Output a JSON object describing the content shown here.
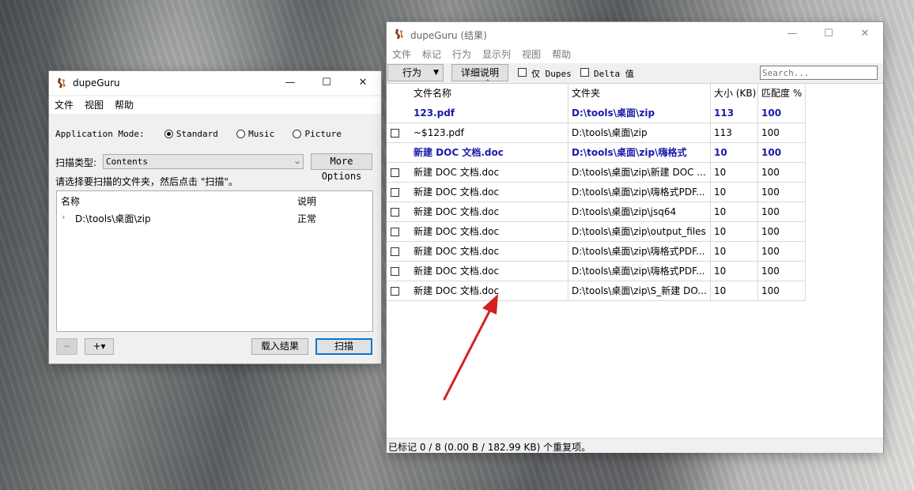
{
  "colors": {
    "ref_text": "#1a1aa8",
    "accent_border": "#0078d7",
    "arrow": "#d32020"
  },
  "main_window": {
    "title": "dupeGuru",
    "controls": {
      "minimize": "—",
      "maximize": "☐",
      "close": "✕"
    },
    "menu": [
      "文件",
      "视图",
      "帮助"
    ],
    "app_mode_label": "Application Mode:",
    "modes": [
      {
        "label": "Standard",
        "selected": true
      },
      {
        "label": "Music",
        "selected": false
      },
      {
        "label": "Picture",
        "selected": false
      }
    ],
    "scan_type_label": "扫描类型:",
    "scan_type_value": "Contents",
    "more_options": "More Options",
    "instruction": "请选择要扫描的文件夹，然后点击 \"扫描\"。",
    "folder_columns": [
      "名称",
      "说明"
    ],
    "folders": [
      {
        "name": "D:\\tools\\桌面\\zip",
        "state": "正常"
      }
    ],
    "remove_btn": "−",
    "add_btn": "+▾",
    "load_results": "载入结果",
    "scan": "扫描"
  },
  "results_window": {
    "title": "dupeGuru (结果)",
    "controls": {
      "minimize": "—",
      "maximize": "☐",
      "close": "✕"
    },
    "menu": [
      "文件",
      "标记",
      "行为",
      "显示列",
      "视图",
      "帮助"
    ],
    "action_btn": "行为",
    "details_btn": "详细说明",
    "dupes_only": "仅 Dupes",
    "delta": "Delta 值",
    "search_placeholder": "Search...",
    "columns": [
      "文件名称",
      "文件夹",
      "大小 (KB)",
      "匹配度 %"
    ],
    "rows": [
      {
        "ref": true,
        "name": "123.pdf",
        "folder": "D:\\tools\\桌面\\zip",
        "size": "113",
        "match": "100"
      },
      {
        "ref": false,
        "name": "~$123.pdf",
        "folder": "D:\\tools\\桌面\\zip",
        "size": "113",
        "match": "100"
      },
      {
        "ref": true,
        "name": "新建 DOC 文档.doc",
        "folder": "D:\\tools\\桌面\\zip\\嗨格式",
        "size": "10",
        "match": "100"
      },
      {
        "ref": false,
        "name": "新建 DOC 文档.doc",
        "folder": "D:\\tools\\桌面\\zip\\新建 DOC ...",
        "size": "10",
        "match": "100"
      },
      {
        "ref": false,
        "name": "新建 DOC 文档.doc",
        "folder": "D:\\tools\\桌面\\zip\\嗨格式PDF...",
        "size": "10",
        "match": "100"
      },
      {
        "ref": false,
        "name": "新建 DOC 文档.doc",
        "folder": "D:\\tools\\桌面\\zip\\jsq64",
        "size": "10",
        "match": "100"
      },
      {
        "ref": false,
        "name": "新建 DOC 文档.doc",
        "folder": "D:\\tools\\桌面\\zip\\output_files",
        "size": "10",
        "match": "100"
      },
      {
        "ref": false,
        "name": "新建 DOC 文档.doc",
        "folder": "D:\\tools\\桌面\\zip\\嗨格式PDF...",
        "size": "10",
        "match": "100"
      },
      {
        "ref": false,
        "name": "新建 DOC 文档.doc",
        "folder": "D:\\tools\\桌面\\zip\\嗨格式PDF...",
        "size": "10",
        "match": "100"
      },
      {
        "ref": false,
        "name": "新建 DOC 文档.doc",
        "folder": "D:\\tools\\桌面\\zip\\S_新建 DO...",
        "size": "10",
        "match": "100"
      }
    ],
    "status": "已标记 0 / 8 (0.00 B / 182.99 KB) 个重复项。"
  }
}
